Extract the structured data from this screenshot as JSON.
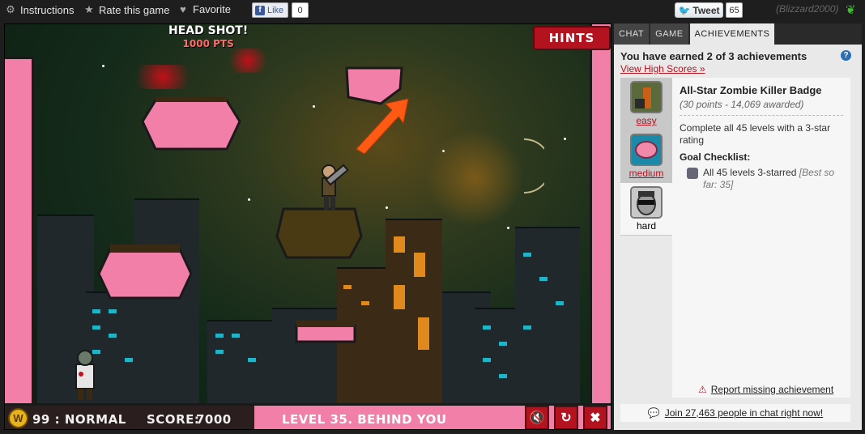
{
  "topbar": {
    "instructions_label": "Instructions",
    "rate_label": "Rate this game",
    "favorite_label": "Favorite",
    "like_label": "Like",
    "like_count": "0",
    "tweet_label": "Tweet",
    "tweet_count": "65",
    "username": "(Blizzard2000)"
  },
  "game": {
    "hints_label": "HINTS",
    "headshot_label": "HEAD SHOT!",
    "headshot_points": "1000 PTS",
    "coin_symbol": "W",
    "difficulty_text": "99 : NORMAL",
    "score_label": "SCORE:",
    "score_value": "7000",
    "level_text": "LEVEL 35. BEHIND YOU"
  },
  "panel": {
    "tabs": [
      {
        "label": "CHAT",
        "active": false
      },
      {
        "label": "GAME",
        "active": false
      },
      {
        "label": "ACHIEVEMENTS",
        "active": true
      }
    ],
    "earned_text": "You have earned 2 of 3 achievements",
    "help_symbol": "?",
    "high_scores_link": "View High Scores »",
    "achievements": [
      {
        "label": "easy",
        "icon": "soldier-badge-icon",
        "selected": false
      },
      {
        "label": "medium",
        "icon": "brain-badge-icon",
        "selected": false
      },
      {
        "label": "hard",
        "icon": "zombie-face-badge-icon",
        "selected": true
      }
    ],
    "detail": {
      "title": "All-Star Zombie Killer Badge",
      "meta": "(30 points - 14,069 awarded)",
      "description": "Complete all 45 levels with a 3-star rating",
      "goal_label": "Goal Checklist:",
      "checklist_item": "All 45 levels 3-starred",
      "checklist_best": "[Best so far: 35]"
    },
    "report_link": "Report missing achievement",
    "join_text": "Join 27,463 people in chat right now!"
  },
  "colors": {
    "pink": "#f27fa8",
    "red": "#b3121f",
    "link_red": "#b3121f"
  }
}
